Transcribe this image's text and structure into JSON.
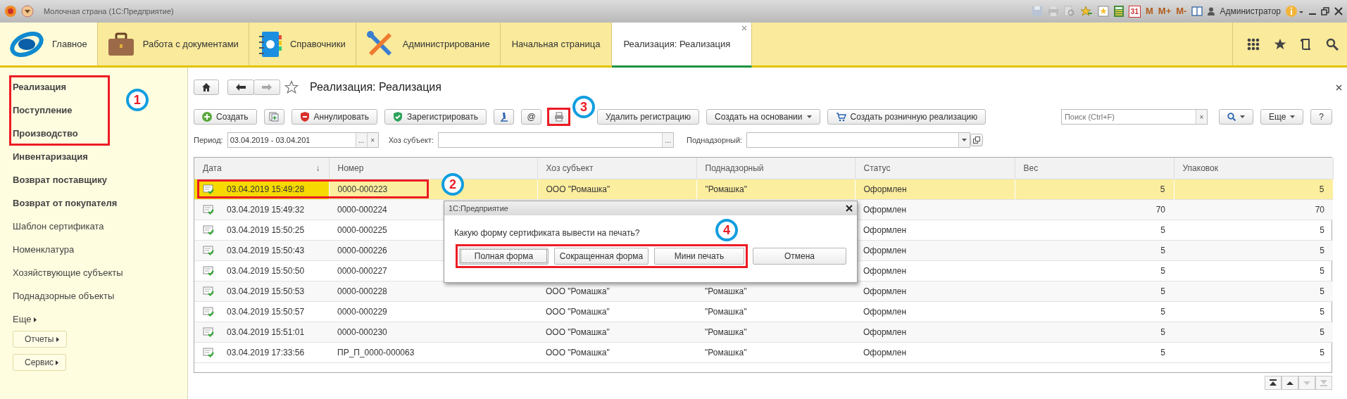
{
  "window": {
    "title": "Молочная страна  (1С:Предприятие)",
    "calendar_day": "31",
    "memory_buttons": [
      "M",
      "M+",
      "M-"
    ],
    "user": "Администратор"
  },
  "sections": [
    {
      "label": "Главное",
      "selected": true
    },
    {
      "label": "Работа с документами",
      "selected": false
    },
    {
      "label": "Справочники",
      "selected": false
    },
    {
      "label": "Администрирование",
      "selected": false
    }
  ],
  "open_tabs": [
    {
      "label": "Начальная страница",
      "selected": false,
      "closable": false
    },
    {
      "label": "Реализация: Реализация",
      "selected": true,
      "closable": true
    }
  ],
  "sidebar": {
    "items": [
      {
        "label": "Реализация",
        "bold": true
      },
      {
        "label": "Поступление",
        "bold": true
      },
      {
        "label": "Производство",
        "bold": true
      },
      {
        "label": "Инвентаризация",
        "bold": true
      },
      {
        "label": "Возврат поставщику",
        "bold": true
      },
      {
        "label": "Возврат от покупателя",
        "bold": true
      },
      {
        "label": "Шаблон сертификата",
        "bold": false
      },
      {
        "label": "Номенклатура",
        "bold": false
      },
      {
        "label": "Хозяйствующие субъекты",
        "bold": false
      },
      {
        "label": "Поднадзорные объекты",
        "bold": false
      }
    ],
    "more": "Еще",
    "buttons": [
      "Отчеты",
      "Сервис"
    ]
  },
  "form": {
    "title": "Реализация: Реализация",
    "toolbar": [
      {
        "kind": "button",
        "label": "Создать"
      },
      {
        "kind": "icon"
      },
      {
        "kind": "button",
        "label": "Аннулировать"
      },
      {
        "kind": "button",
        "label": "Зарегистрировать"
      },
      {
        "kind": "icon"
      },
      {
        "kind": "button",
        "label": "@"
      },
      {
        "kind": "icon"
      },
      {
        "kind": "button",
        "label": "Удалить регистрацию"
      },
      {
        "kind": "dropdown",
        "label": "Создать на основании"
      },
      {
        "kind": "button",
        "label": "Создать розничную реализацию"
      }
    ],
    "search": {
      "placeholder": "Поиск (Ctrl+F)",
      "clear": "×"
    },
    "more": "Еще",
    "help": "?",
    "filters": {
      "period": {
        "label": "Период:",
        "value": "03.04.2019 - 03.04.201",
        "select": "...",
        "clear": "×"
      },
      "subject": {
        "label": "Хоз субъект:",
        "select": "..."
      },
      "supervised": {
        "label": "Поднадзорный:"
      }
    }
  },
  "table": {
    "columns": [
      {
        "label": "Дата",
        "sort_mark": "↓"
      },
      {
        "label": "Номер"
      },
      {
        "label": "Хоз субъект"
      },
      {
        "label": "Поднадзорный"
      },
      {
        "label": "Статус"
      },
      {
        "label": "Вес"
      },
      {
        "label": "Упаковок"
      }
    ],
    "rows": [
      {
        "date": "03.04.2019 15:49:28",
        "number": "0000-000223",
        "subject": "ООО \"Ромашка\"",
        "supervised": "\"Ромашка\"",
        "status": "Оформлен",
        "weight": "5",
        "packages": "5",
        "selected": true
      },
      {
        "date": "03.04.2019 15:49:32",
        "number": "0000-000224",
        "status": "Оформлен",
        "weight": "70",
        "packages": "70",
        "selected": false
      },
      {
        "date": "03.04.2019 15:50:25",
        "number": "0000-000225",
        "status": "Оформлен",
        "weight": "5",
        "packages": "5",
        "selected": false
      },
      {
        "date": "03.04.2019 15:50:43",
        "number": "0000-000226",
        "status": "Оформлен",
        "weight": "5",
        "packages": "5",
        "selected": false
      },
      {
        "date": "03.04.2019 15:50:50",
        "number": "0000-000227",
        "status": "Оформлен",
        "weight": "5",
        "packages": "5",
        "selected": false
      },
      {
        "date": "03.04.2019 15:50:53",
        "number": "0000-000228",
        "subject": "ООО \"Ромашка\"",
        "supervised": "\"Ромашка\"",
        "status": "Оформлен",
        "weight": "5",
        "packages": "5",
        "selected": false
      },
      {
        "date": "03.04.2019 15:50:57",
        "number": "0000-000229",
        "subject": "ООО \"Ромашка\"",
        "supervised": "\"Ромашка\"",
        "status": "Оформлен",
        "weight": "5",
        "packages": "5",
        "selected": false
      },
      {
        "date": "03.04.2019 15:51:01",
        "number": "0000-000230",
        "subject": "ООО \"Ромашка\"",
        "supervised": "\"Ромашка\"",
        "status": "Оформлен",
        "weight": "5",
        "packages": "5",
        "selected": false
      },
      {
        "date": "03.04.2019 17:33:56",
        "number": "ПР_П_0000-000063",
        "subject": "ООО \"Ромашка\"",
        "supervised": "\"Ромашка\"",
        "status": "Оформлен",
        "weight": "5",
        "packages": "5",
        "selected": false
      }
    ],
    "pager": [
      {
        "kind": "first",
        "disabled": false
      },
      {
        "kind": "up",
        "disabled": false
      },
      {
        "kind": "down",
        "disabled": true
      },
      {
        "kind": "last",
        "disabled": true
      }
    ]
  },
  "dialog": {
    "title": "1С:Предприятие",
    "question": "Какую форму сертификата вывести на печать?",
    "buttons": [
      {
        "label": "Полная форма",
        "focused": true
      },
      {
        "label": "Сокращенная форма",
        "focused": false
      },
      {
        "label": "Мини печать",
        "focused": false
      },
      {
        "label": "Отмена",
        "focused": false
      }
    ]
  },
  "annotations": [
    {
      "label": "1"
    },
    {
      "label": "2"
    },
    {
      "label": "3"
    },
    {
      "label": "4"
    }
  ]
}
